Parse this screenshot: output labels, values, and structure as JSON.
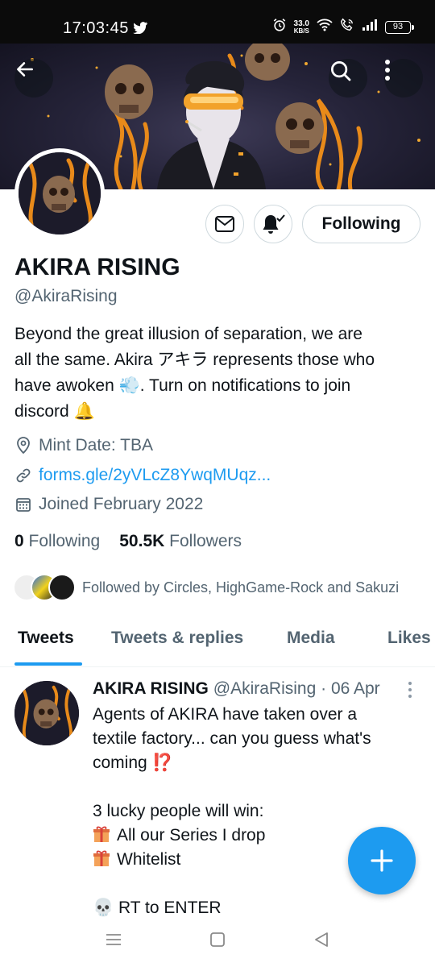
{
  "status_bar": {
    "time": "17:03:45",
    "net_speed_value": "33.0",
    "net_speed_unit": "KB/S",
    "battery": "93"
  },
  "profile": {
    "name": "AKIRA RISING",
    "handle": "@AkiraRising",
    "bio_line1": "Beyond the great illusion of separation, we are",
    "bio_line2": "all the same. Akira アキラ represents those who",
    "bio_line3": "have awoken 💨. Turn on notifications to join",
    "bio_line4": "discord 🔔",
    "location": "Mint Date: TBA",
    "website": "forms.gle/2yVLcZ8YwqMUqz...",
    "joined": "Joined February 2022",
    "following_count": "0",
    "following_label": "Following",
    "followers_count": "50.5K",
    "followers_label": "Followers",
    "followed_by": "Followed by Circles, HighGame-Rock and Sakuzi"
  },
  "actions": {
    "following_button": "Following"
  },
  "tabs": [
    {
      "label": "Tweets",
      "active": true
    },
    {
      "label": "Tweets & replies",
      "active": false
    },
    {
      "label": "Media",
      "active": false
    },
    {
      "label": "Likes",
      "active": false
    }
  ],
  "tweet": {
    "author_name": "AKIRA RISING",
    "author_handle": "@AkiraRising",
    "separator": " · ",
    "date": "06 Apr",
    "line1": "Agents of AKIRA have taken over a",
    "line2": "textile factory... can you guess what's",
    "line3": "coming ⁉️",
    "line4": "3 lucky people will win:",
    "line5": "All our Series I drop",
    "line6": "Whitelist",
    "line7": "💀 RT to ENTER"
  },
  "colors": {
    "accent": "#1d9bf0",
    "text_primary": "#0f1419",
    "text_secondary": "#536471",
    "border": "#cfd9de"
  },
  "icons": [
    "back-arrow-icon",
    "search-icon",
    "more-vertical-icon",
    "mail-icon",
    "bell-icon",
    "location-icon",
    "link-icon",
    "calendar-icon",
    "plus-icon",
    "menu-icon",
    "home-square-icon",
    "back-triangle-icon"
  ]
}
